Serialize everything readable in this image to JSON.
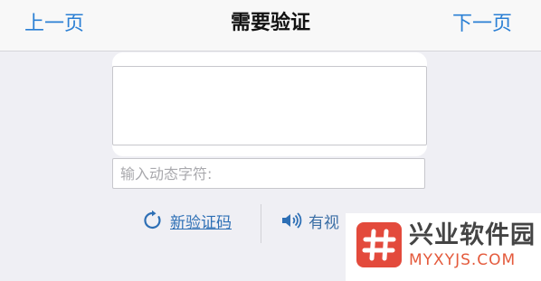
{
  "navbar": {
    "prev_label": "上一页",
    "title": "需要验证",
    "next_label": "下一页"
  },
  "captcha": {
    "input_placeholder": "输入动态字符:",
    "input_value": "",
    "refresh_label": "新验证码",
    "audio_label": "有视"
  },
  "watermark": {
    "name": "兴业软件园",
    "url": "MYXYJS.COM"
  },
  "colors": {
    "accent": "#2a7fd4",
    "link": "#2d6fb5",
    "watermark_red": "#e34a3c"
  }
}
